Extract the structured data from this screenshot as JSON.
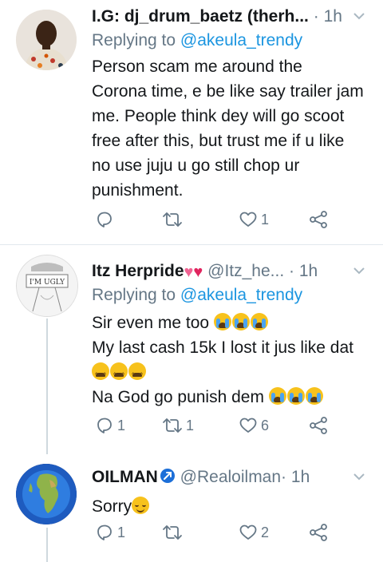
{
  "tweets": [
    {
      "name": "I.G: dj_drum_baetz (therh...",
      "handle": "",
      "dot": "·",
      "time": "1h",
      "replying_label": "Replying to",
      "replying_to": "@akeula_trendy",
      "body_lines": [
        "Person scam me around the",
        "Corona time, e be like say trailer jam",
        "me. People think dey will go scoot",
        "free after this, but trust me if u like",
        "no use juju u go still chop ur",
        "punishment."
      ],
      "counts": {
        "replies": "",
        "retweets": "",
        "likes": "1"
      }
    },
    {
      "name": "Itz Herpride",
      "name_emojis": [
        "heart-sparkle",
        "heart-red"
      ],
      "handle": "@Itz_he...",
      "dot": "·",
      "time": "1h",
      "replying_label": "Replying to",
      "replying_to": "@akeula_trendy",
      "avatar_text": "I'M UGLY",
      "body_lines": [
        "Sir even me too",
        "My last cash 15k I lost it jus like dat",
        "",
        "Na God go punish dem"
      ],
      "counts": {
        "replies": "1",
        "retweets": "1",
        "likes": "6"
      }
    },
    {
      "name": "OILMAN",
      "handle": "@Realoilman",
      "dot": "·",
      "time": "1h",
      "body_lines": [
        "Sorry"
      ],
      "counts": {
        "replies": "1",
        "retweets": "",
        "likes": "2"
      }
    }
  ],
  "colors": {
    "link": "#1b95e0",
    "muted": "#657786",
    "text": "#14171a",
    "divider": "#e1e8ed",
    "heart_red": "#e0245e"
  },
  "icons": [
    "reply-icon",
    "retweet-icon",
    "like-icon",
    "share-icon",
    "chevron-down-icon",
    "verified-arrow-icon"
  ]
}
